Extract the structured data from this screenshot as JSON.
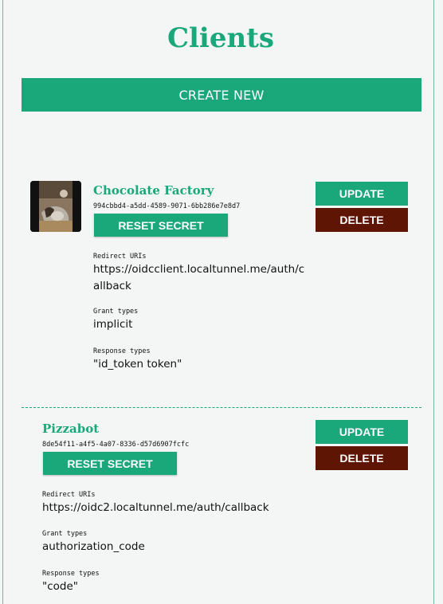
{
  "page": {
    "title": "Clients",
    "create_label": "CREATE NEW"
  },
  "colors": {
    "accent": "#1aa77a",
    "danger": "#5e1504",
    "background": "#f4f6f6"
  },
  "clients": [
    {
      "name": "Chocolate Factory",
      "client_id": "994cbbd4-a5dd-4589-9071-6bb286e7e8d7",
      "reset_label": "RESET SECRET",
      "update_label": "UPDATE",
      "delete_label": "DELETE",
      "redirect_label": "Redirect URIs",
      "redirect_value": "https://oidcclient.localtunnel.me/auth/callback",
      "grant_label": "Grant types",
      "grant_value": "implicit",
      "response_label": "Response types",
      "response_value": "\"id_token token\""
    },
    {
      "name": "Pizzabot",
      "client_id": "8de54f11-a4f5-4a07-8336-d57d6907fcfc",
      "reset_label": "RESET SECRET",
      "update_label": "UPDATE",
      "delete_label": "DELETE",
      "redirect_label": "Redirect URIs",
      "redirect_value": "https://oidc2.localtunnel.me/auth/callback",
      "grant_label": "Grant types",
      "grant_value": "authorization_code",
      "response_label": "Response types",
      "response_value": "\"code\""
    }
  ]
}
